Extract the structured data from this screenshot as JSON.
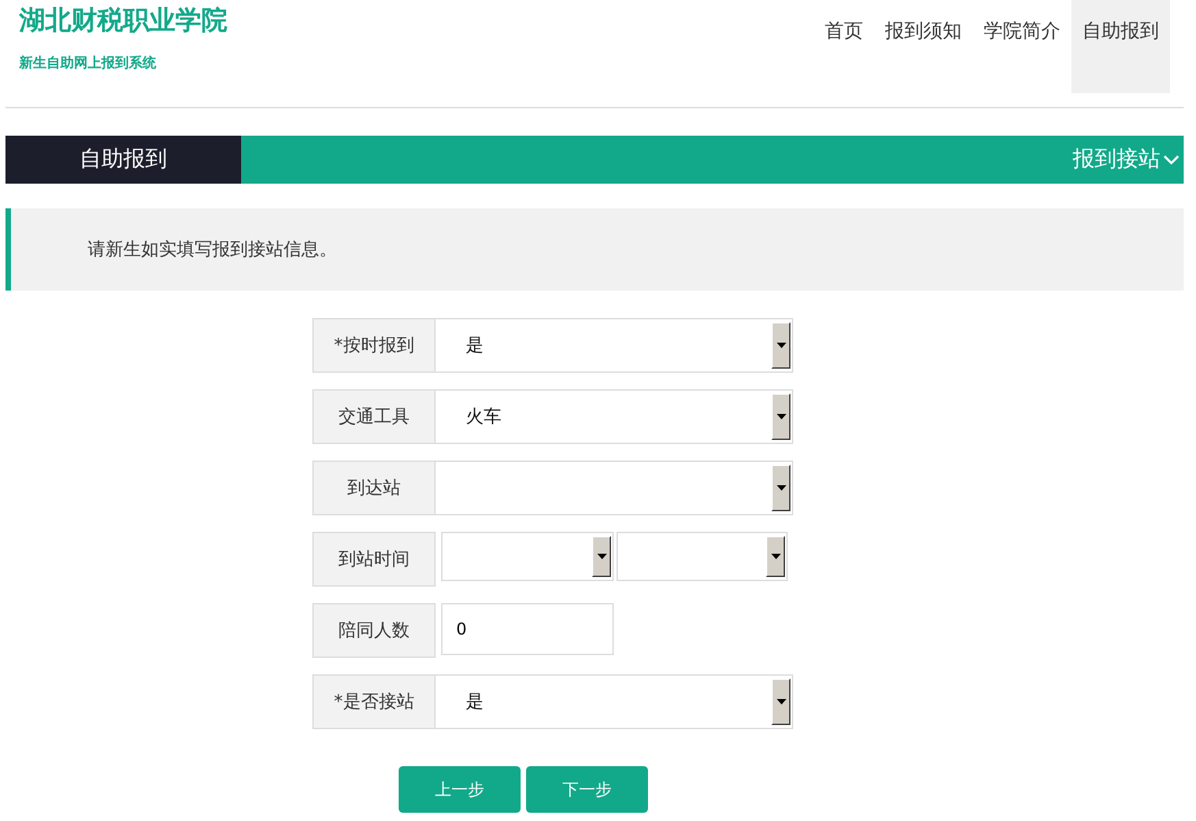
{
  "header": {
    "title": "湖北财税职业学院",
    "subtitle": "新生自助网上报到系统"
  },
  "nav": [
    {
      "label": "首页",
      "selected": false
    },
    {
      "label": "报到须知",
      "selected": false
    },
    {
      "label": "学院简介",
      "selected": false
    },
    {
      "label": "自助报到",
      "selected": true
    }
  ],
  "section_bar": {
    "title": "自助报到",
    "step": "报到接站"
  },
  "notice": "请新生如实填写报到接站信息。",
  "fields": [
    {
      "kind": "select",
      "label": "*按时报到",
      "value": "是"
    },
    {
      "kind": "select",
      "label": "交通工具",
      "value": "火车"
    },
    {
      "kind": "select",
      "label": "到达站"
    },
    {
      "kind": "double-select",
      "label": "到站时间"
    },
    {
      "kind": "text",
      "label": "陪同人数",
      "value": "0"
    },
    {
      "kind": "select",
      "label": "*是否接站",
      "value": "是"
    }
  ],
  "buttons": [
    "上一步",
    "下一步"
  ]
}
